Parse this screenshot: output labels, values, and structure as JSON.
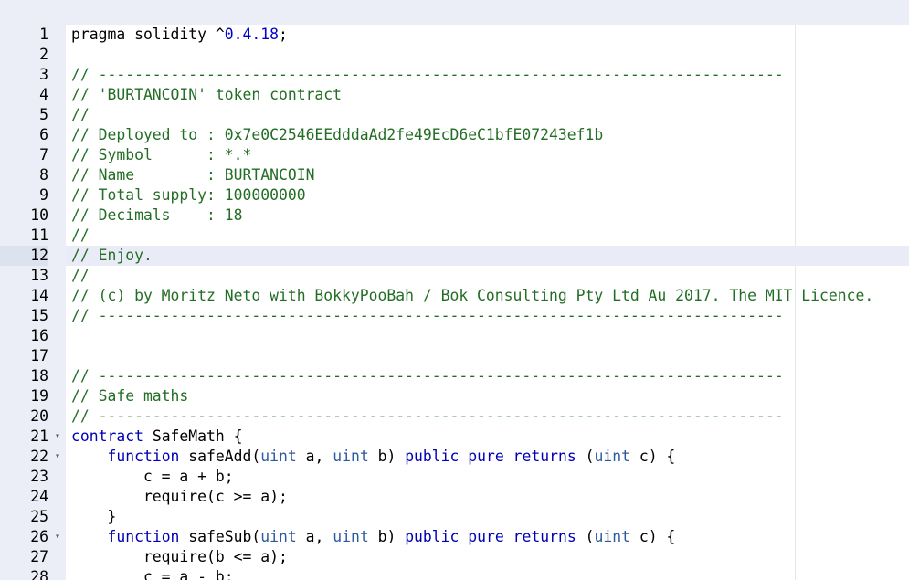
{
  "colors": {
    "gutter_bg": "#ebeef6",
    "active_line_bg": "#e9ecf7",
    "keyword": "#0000b5",
    "comment": "#236e24",
    "number": "#0000cd"
  },
  "editor": {
    "active_line": 12,
    "lines": [
      {
        "n": "1",
        "fold": "",
        "tokens": [
          {
            "t": "plain",
            "v": "pragma solidity "
          },
          {
            "t": "op",
            "v": "^"
          },
          {
            "t": "num",
            "v": "0.4.18"
          },
          {
            "t": "plain",
            "v": ";"
          }
        ]
      },
      {
        "n": "2",
        "fold": "",
        "tokens": []
      },
      {
        "n": "3",
        "fold": "",
        "tokens": [
          {
            "t": "cm",
            "v": "// ----------------------------------------------------------------------------"
          }
        ]
      },
      {
        "n": "4",
        "fold": "",
        "tokens": [
          {
            "t": "cm",
            "v": "// 'BURTANCOIN' token contract"
          }
        ]
      },
      {
        "n": "5",
        "fold": "",
        "tokens": [
          {
            "t": "cm",
            "v": "//"
          }
        ]
      },
      {
        "n": "6",
        "fold": "",
        "tokens": [
          {
            "t": "cm",
            "v": "// Deployed to : 0x7e0C2546EEdddaAd2fe49EcD6eC1bfE07243ef1b"
          }
        ]
      },
      {
        "n": "7",
        "fold": "",
        "tokens": [
          {
            "t": "cm",
            "v": "// Symbol      : *.*"
          }
        ]
      },
      {
        "n": "8",
        "fold": "",
        "tokens": [
          {
            "t": "cm",
            "v": "// Name        : BURTANCOIN"
          }
        ]
      },
      {
        "n": "9",
        "fold": "",
        "tokens": [
          {
            "t": "cm",
            "v": "// Total supply: 100000000"
          }
        ]
      },
      {
        "n": "10",
        "fold": "",
        "tokens": [
          {
            "t": "cm",
            "v": "// Decimals    : 18"
          }
        ]
      },
      {
        "n": "11",
        "fold": "",
        "tokens": [
          {
            "t": "cm",
            "v": "//"
          }
        ]
      },
      {
        "n": "12",
        "fold": "",
        "tokens": [
          {
            "t": "cm",
            "v": "// Enjoy."
          }
        ]
      },
      {
        "n": "13",
        "fold": "",
        "tokens": [
          {
            "t": "cm",
            "v": "//"
          }
        ]
      },
      {
        "n": "14",
        "fold": "",
        "tokens": [
          {
            "t": "cm",
            "v": "// (c) by Moritz Neto with BokkyPooBah / Bok Consulting Pty Ltd Au 2017. The MIT Licence."
          }
        ]
      },
      {
        "n": "15",
        "fold": "",
        "tokens": [
          {
            "t": "cm",
            "v": "// ----------------------------------------------------------------------------"
          }
        ]
      },
      {
        "n": "16",
        "fold": "",
        "tokens": []
      },
      {
        "n": "17",
        "fold": "",
        "tokens": []
      },
      {
        "n": "18",
        "fold": "",
        "tokens": [
          {
            "t": "cm",
            "v": "// ----------------------------------------------------------------------------"
          }
        ]
      },
      {
        "n": "19",
        "fold": "",
        "tokens": [
          {
            "t": "cm",
            "v": "// Safe maths"
          }
        ]
      },
      {
        "n": "20",
        "fold": "",
        "tokens": [
          {
            "t": "cm",
            "v": "// ----------------------------------------------------------------------------"
          }
        ]
      },
      {
        "n": "21",
        "fold": "▾",
        "tokens": [
          {
            "t": "kw",
            "v": "contract"
          },
          {
            "t": "plain",
            "v": " SafeMath {"
          }
        ]
      },
      {
        "n": "22",
        "fold": "▾",
        "tokens": [
          {
            "t": "plain",
            "v": "    "
          },
          {
            "t": "kw",
            "v": "function"
          },
          {
            "t": "plain",
            "v": " safeAdd("
          },
          {
            "t": "type",
            "v": "uint"
          },
          {
            "t": "plain",
            "v": " a, "
          },
          {
            "t": "type",
            "v": "uint"
          },
          {
            "t": "plain",
            "v": " b) "
          },
          {
            "t": "kw",
            "v": "public"
          },
          {
            "t": "plain",
            "v": " "
          },
          {
            "t": "kw",
            "v": "pure"
          },
          {
            "t": "plain",
            "v": " "
          },
          {
            "t": "kw",
            "v": "returns"
          },
          {
            "t": "plain",
            "v": " ("
          },
          {
            "t": "type",
            "v": "uint"
          },
          {
            "t": "plain",
            "v": " c) {"
          }
        ]
      },
      {
        "n": "23",
        "fold": "",
        "tokens": [
          {
            "t": "plain",
            "v": "        c = a + b;"
          }
        ]
      },
      {
        "n": "24",
        "fold": "",
        "tokens": [
          {
            "t": "plain",
            "v": "        require(c >= a);"
          }
        ]
      },
      {
        "n": "25",
        "fold": "",
        "tokens": [
          {
            "t": "plain",
            "v": "    }"
          }
        ]
      },
      {
        "n": "26",
        "fold": "▾",
        "tokens": [
          {
            "t": "plain",
            "v": "    "
          },
          {
            "t": "kw",
            "v": "function"
          },
          {
            "t": "plain",
            "v": " safeSub("
          },
          {
            "t": "type",
            "v": "uint"
          },
          {
            "t": "plain",
            "v": " a, "
          },
          {
            "t": "type",
            "v": "uint"
          },
          {
            "t": "plain",
            "v": " b) "
          },
          {
            "t": "kw",
            "v": "public"
          },
          {
            "t": "plain",
            "v": " "
          },
          {
            "t": "kw",
            "v": "pure"
          },
          {
            "t": "plain",
            "v": " "
          },
          {
            "t": "kw",
            "v": "returns"
          },
          {
            "t": "plain",
            "v": " ("
          },
          {
            "t": "type",
            "v": "uint"
          },
          {
            "t": "plain",
            "v": " c) {"
          }
        ]
      },
      {
        "n": "27",
        "fold": "",
        "tokens": [
          {
            "t": "plain",
            "v": "        require(b <= a);"
          }
        ]
      },
      {
        "n": "28",
        "fold": "",
        "tokens": [
          {
            "t": "plain",
            "v": "        c = a - b;"
          }
        ]
      }
    ]
  }
}
